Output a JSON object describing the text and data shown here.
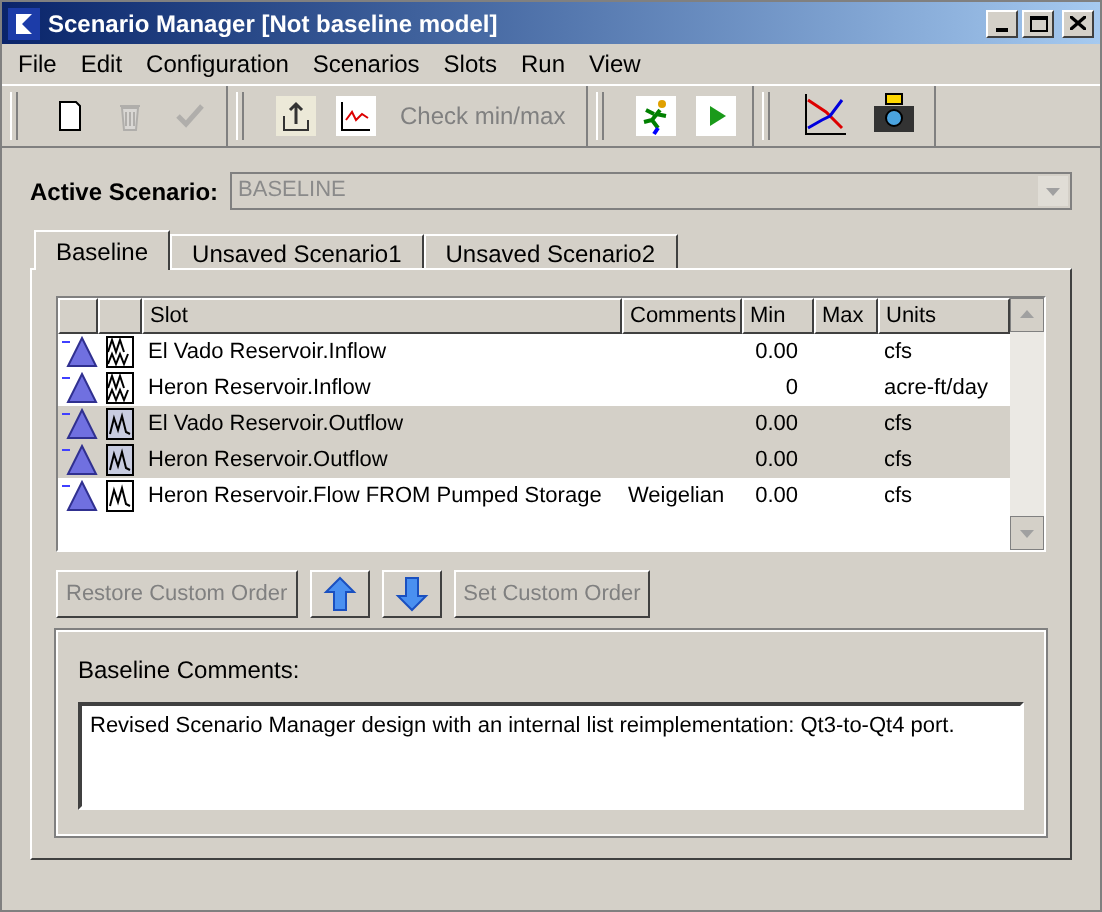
{
  "window": {
    "title": "Scenario Manager [Not baseline model]"
  },
  "menu": [
    "File",
    "Edit",
    "Configuration",
    "Scenarios",
    "Slots",
    "Run",
    "View"
  ],
  "toolbar": [
    [
      {
        "kind": "new",
        "disabled": false
      },
      {
        "kind": "delete",
        "disabled": true
      },
      {
        "kind": "check",
        "disabled": true
      }
    ],
    [
      {
        "kind": "export",
        "disabled": false
      },
      {
        "kind": "plot",
        "disabled": false
      },
      {
        "kind": "text",
        "label": "Check min/max",
        "disabled": true
      }
    ],
    [
      {
        "kind": "runner",
        "disabled": false
      },
      {
        "kind": "play",
        "disabled": false
      }
    ],
    [
      {
        "kind": "chart",
        "disabled": false
      },
      {
        "kind": "camera",
        "disabled": false
      }
    ]
  ],
  "active_scenario": {
    "label": "Active Scenario:",
    "value": "BASELINE"
  },
  "tabs": [
    {
      "label": "Baseline",
      "selected": true
    },
    {
      "label": "Unsaved Scenario1",
      "selected": false
    },
    {
      "label": "Unsaved Scenario2",
      "selected": false
    }
  ],
  "table": {
    "columns": [
      "Slot",
      "Comments",
      "Min",
      "Max",
      "Units"
    ],
    "rows": [
      {
        "slot": "El Vado Reservoir.Inflow",
        "comments": "",
        "min": "0.00",
        "max": "",
        "units": "cfs",
        "kind": "multi",
        "selected": false
      },
      {
        "slot": "Heron Reservoir.Inflow",
        "comments": "",
        "min": "0",
        "max": "",
        "units": "acre-ft/day",
        "kind": "multi",
        "selected": false
      },
      {
        "slot": "El Vado Reservoir.Outflow",
        "comments": "",
        "min": "0.00",
        "max": "",
        "units": "cfs",
        "kind": "single",
        "selected": true
      },
      {
        "slot": "Heron Reservoir.Outflow",
        "comments": "",
        "min": "0.00",
        "max": "",
        "units": "cfs",
        "kind": "single",
        "selected": true
      },
      {
        "slot": "Heron Reservoir.Flow FROM Pumped Storage",
        "comments": "Weigelian",
        "min": "0.00",
        "max": "",
        "units": "cfs",
        "kind": "single",
        "selected": false
      }
    ]
  },
  "order_buttons": [
    {
      "kind": "text",
      "label": "Restore Custom Order",
      "disabled": true
    },
    {
      "kind": "up"
    },
    {
      "kind": "down"
    },
    {
      "kind": "text",
      "label": "Set Custom Order",
      "disabled": true
    }
  ],
  "comments": {
    "label": "Baseline Comments:",
    "value": "Revised Scenario Manager design with an internal list reimplementation: Qt3-to-Qt4 port."
  }
}
